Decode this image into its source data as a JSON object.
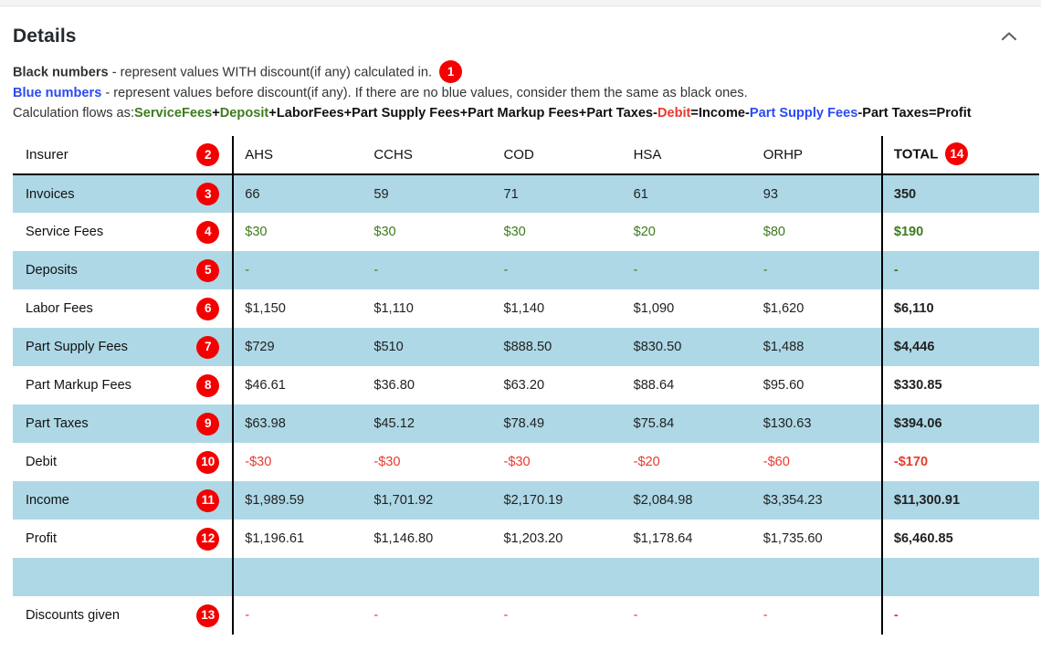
{
  "panel": {
    "title": "Details",
    "collapse_icon": "chevron-up-icon"
  },
  "legend": {
    "line1_bold": "Black numbers",
    "line1_rest": " - represent values WITH discount(if any) calculated in.",
    "line1_badge": "1",
    "line2_bold": "Blue numbers",
    "line2_rest": " - represent values before discount(if any). If there are no blue values, consider them the same as black ones.",
    "line3_prefix": "Calculation flows as:",
    "formula_tokens": [
      {
        "text": "ServiceFees",
        "color": "green"
      },
      {
        "text": "+",
        "color": "black"
      },
      {
        "text": "Deposit",
        "color": "green"
      },
      {
        "text": "+",
        "color": "black"
      },
      {
        "text": "LaborFees",
        "color": "black"
      },
      {
        "text": "+",
        "color": "black"
      },
      {
        "text": "Part Supply Fees",
        "color": "black"
      },
      {
        "text": "+",
        "color": "black"
      },
      {
        "text": "Part Markup Fees",
        "color": "black"
      },
      {
        "text": "+",
        "color": "black"
      },
      {
        "text": "Part Taxes",
        "color": "black"
      },
      {
        "text": "-",
        "color": "black"
      },
      {
        "text": "Debit",
        "color": "red"
      },
      {
        "text": "=",
        "color": "black"
      },
      {
        "text": "Income",
        "color": "black"
      },
      {
        "text": "-",
        "color": "black"
      },
      {
        "text": "Part Supply Fees",
        "color": "blue"
      },
      {
        "text": "-",
        "color": "black"
      },
      {
        "text": "Part Taxes",
        "color": "black"
      },
      {
        "text": "=",
        "color": "black"
      },
      {
        "text": "Profit",
        "color": "black"
      }
    ]
  },
  "table": {
    "header": {
      "label": "Insurer",
      "label_badge": "2",
      "columns": [
        "AHS",
        "CCHS",
        "COD",
        "HSA",
        "ORHP"
      ],
      "total_label": "TOTAL",
      "total_badge": "14"
    },
    "rows": [
      {
        "label": "Invoices",
        "badge": "3",
        "label_color": "black",
        "value_color": "black",
        "shade": "blue",
        "values": [
          "66",
          "59",
          "71",
          "61",
          "93"
        ],
        "total": "350"
      },
      {
        "label": "Service Fees",
        "badge": "4",
        "label_color": "green",
        "value_color": "green",
        "shade": "white",
        "values": [
          "$30",
          "$30",
          "$30",
          "$20",
          "$80"
        ],
        "total": "$190"
      },
      {
        "label": "Deposits",
        "badge": "5",
        "label_color": "green",
        "value_color": "green",
        "shade": "blue",
        "values": [
          "-",
          "-",
          "-",
          "-",
          "-"
        ],
        "total": "-"
      },
      {
        "label": "Labor Fees",
        "badge": "6",
        "label_color": "black",
        "value_color": "black",
        "shade": "white",
        "values": [
          "$1,150",
          "$1,110",
          "$1,140",
          "$1,090",
          "$1,620"
        ],
        "total": "$6,110"
      },
      {
        "label": "Part Supply Fees",
        "badge": "7",
        "label_color": "black",
        "value_color": "black",
        "shade": "blue",
        "values": [
          "$729",
          "$510",
          "$888.50",
          "$830.50",
          "$1,488"
        ],
        "total": "$4,446"
      },
      {
        "label": "Part Markup Fees",
        "badge": "8",
        "label_color": "black",
        "value_color": "black",
        "shade": "white",
        "values": [
          "$46.61",
          "$36.80",
          "$63.20",
          "$88.64",
          "$95.60"
        ],
        "total": "$330.85"
      },
      {
        "label": "Part Taxes",
        "badge": "9",
        "label_color": "black",
        "value_color": "black",
        "shade": "blue",
        "values": [
          "$63.98",
          "$45.12",
          "$78.49",
          "$75.84",
          "$130.63"
        ],
        "total": "$394.06"
      },
      {
        "label": "Debit",
        "badge": "10",
        "label_color": "red",
        "value_color": "red",
        "shade": "white",
        "values": [
          "-$30",
          "-$30",
          "-$30",
          "-$20",
          "-$60"
        ],
        "total": "-$170"
      },
      {
        "label": "Income",
        "badge": "11",
        "label_color": "black",
        "value_color": "black",
        "shade": "blue",
        "values": [
          "$1,989.59",
          "$1,701.92",
          "$2,170.19",
          "$2,084.98",
          "$3,354.23"
        ],
        "total": "$11,300.91"
      },
      {
        "label": "Profit",
        "badge": "12",
        "label_color": "black",
        "value_color": "black",
        "shade": "white",
        "values": [
          "$1,196.61",
          "$1,146.80",
          "$1,203.20",
          "$1,178.64",
          "$1,735.60"
        ],
        "total": "$6,460.85"
      },
      {
        "label": "",
        "badge": "",
        "label_color": "black",
        "value_color": "black",
        "shade": "blue",
        "values": [
          "",
          "",
          "",
          "",
          ""
        ],
        "total": ""
      },
      {
        "label": "Discounts given",
        "badge": "13",
        "label_color": "red",
        "value_color": "red",
        "shade": "white",
        "values": [
          "-",
          "-",
          "-",
          "-",
          "-"
        ],
        "total": "-"
      }
    ]
  },
  "colors": {
    "row_shade_blue": "#aed8e6",
    "badge_red": "#f40000",
    "green": "#3d7c1f",
    "red": "#e83a30",
    "blue": "#2b4bf2"
  }
}
